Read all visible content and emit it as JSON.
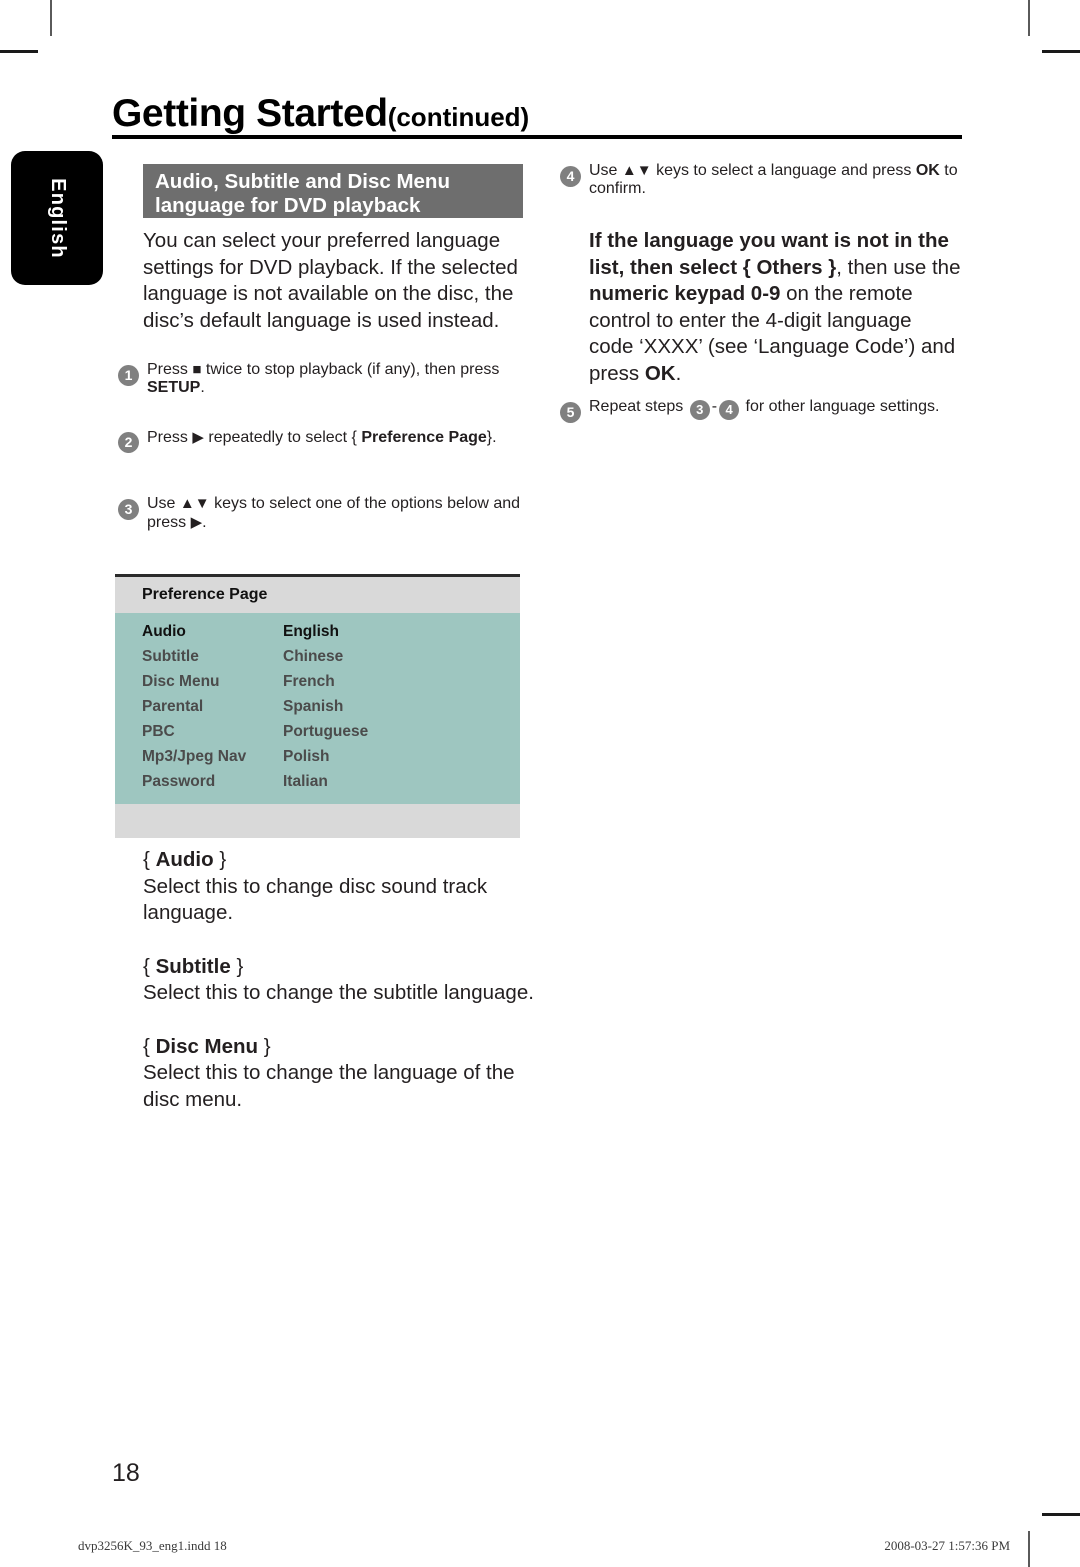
{
  "page": {
    "title_main": "Getting Started",
    "title_suffix": "(continued)",
    "language_tab": "English",
    "page_number": "18",
    "footer_left": "dvp3256K_93_eng1.indd   18",
    "footer_right": "2008-03-27   1:57:36 PM"
  },
  "section": {
    "band_line1": "Audio, Subtitle and Disc Menu",
    "band_line2": "language for DVD playback",
    "intro": "You can select your preferred language settings for DVD playback. If the selected language is not available on the disc, the disc’s default language is used instead."
  },
  "steps": {
    "s1_num": "1",
    "s1_a": "Press",
    "s1_icon": "stop-square-icon",
    "s1_b": "twice to stop playback (if any), then press",
    "s1_bold": "SETUP",
    "s1_end": ".",
    "s2_num": "2",
    "s2_a": "Press",
    "s2_icon": "right-triangle-icon",
    "s2_b": "repeatedly to select {",
    "s2_bold": "Preference Page",
    "s2_end": "}.",
    "s3_num": "3",
    "s3_a": "Use",
    "s3_icon_up": "up-triangle-icon",
    "s3_icon_down": "down-triangle-icon",
    "s3_b": "keys to select one of the options below and press",
    "s3_icon_right": "right-triangle-icon",
    "s3_end": ".",
    "s4_num": "4",
    "s4_a": "Use",
    "s4_b": "keys to select a language and press",
    "s4_bold": "OK",
    "s4_end": "to confirm.",
    "note_bold1": "If the language you want is not in the list, then select { Others }",
    "note_mid1": ", then use the ",
    "note_bold2": "numeric keypad 0-9",
    "note_mid2": " on the remote control to enter the 4-digit language code ‘XXXX’ (see ‘Language Code’) and press ",
    "note_bold3": "OK",
    "note_end": ".",
    "s5_num": "5",
    "s5_a": "Repeat steps",
    "s5_ref1": "3",
    "s5_dash": "-",
    "s5_ref2": "4",
    "s5_b": "for other language settings."
  },
  "preference_table": {
    "title": "Preference Page",
    "rows": [
      {
        "setting": "Audio",
        "value": "English"
      },
      {
        "setting": "Subtitle",
        "value": "Chinese"
      },
      {
        "setting": "Disc Menu",
        "value": "French"
      },
      {
        "setting": "Parental",
        "value": "Spanish"
      },
      {
        "setting": "PBC",
        "value": "Portuguese"
      },
      {
        "setting": "Mp3/Jpeg Nav",
        "value": "Polish"
      },
      {
        "setting": "Password",
        "value": "Italian"
      }
    ]
  },
  "options": [
    {
      "head_open": "{",
      "head_bold": "Audio",
      "head_close": "}",
      "body": "Select this to change disc sound track language."
    },
    {
      "head_open": "{",
      "head_bold": "Subtitle",
      "head_close": "}",
      "body": "Select this to change the subtitle language."
    },
    {
      "head_open": "{",
      "head_bold": "Disc Menu",
      "head_close": "}",
      "body": "Select this to change the language of the disc menu."
    }
  ],
  "colors": {
    "band_gray": "#6e6e6e",
    "table_teal": "#9ec6c0",
    "table_gray": "#d9d9d9",
    "step_circle": "#808080",
    "tab_black": "#000000"
  }
}
